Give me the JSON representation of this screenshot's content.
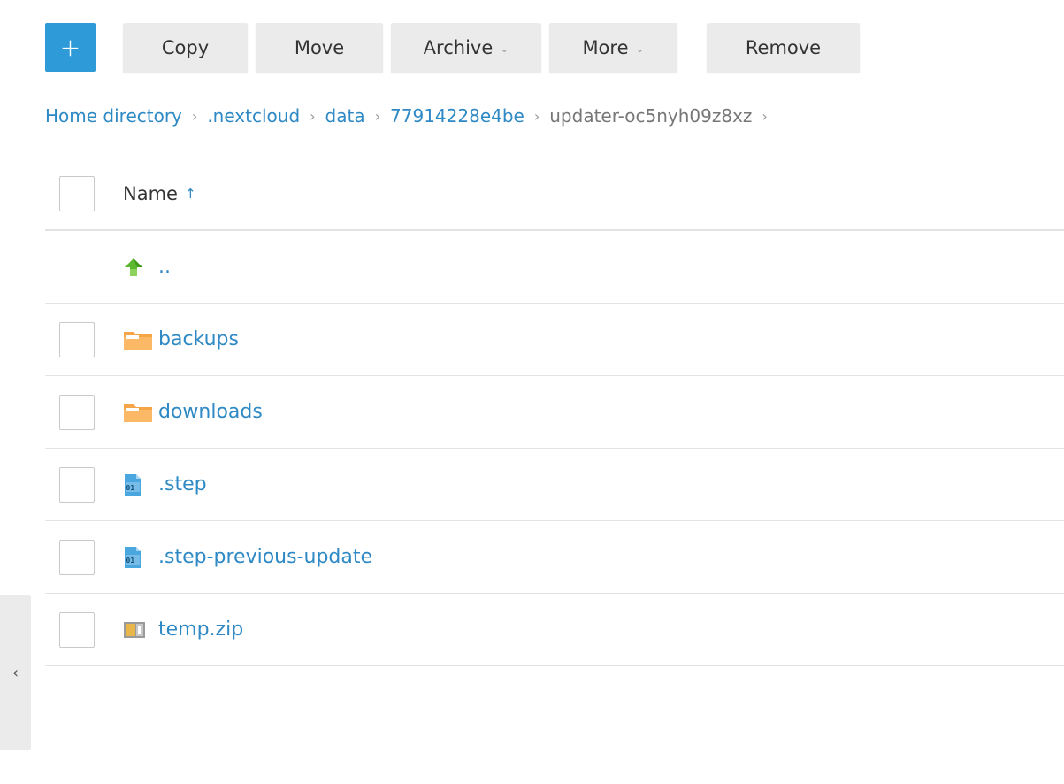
{
  "toolbar": {
    "add_label": "+",
    "copy_label": "Copy",
    "move_label": "Move",
    "archive_label": "Archive",
    "more_label": "More",
    "remove_label": "Remove",
    "caret": "⌄"
  },
  "breadcrumb": {
    "items": [
      "Home directory",
      ".nextcloud",
      "data",
      "77914228e4be"
    ],
    "current": "updater-oc5nyh09z8xz",
    "separator": "›"
  },
  "list": {
    "header_name": "Name",
    "sort_indicator": "↑",
    "parent_label": "..",
    "rows": [
      {
        "name": "backups",
        "icon": "folder-icon"
      },
      {
        "name": "downloads",
        "icon": "folder-icon"
      },
      {
        "name": ".step",
        "icon": "binary-file-icon"
      },
      {
        "name": ".step-previous-update",
        "icon": "binary-file-icon"
      },
      {
        "name": "temp.zip",
        "icon": "archive-file-icon"
      }
    ]
  },
  "side_panel": {
    "toggle_glyph": "‹"
  },
  "colors": {
    "accent": "#2e9ad8",
    "link": "#2e89c4",
    "folder": "#f6a546",
    "parent_arrow": "#5cb82e"
  }
}
